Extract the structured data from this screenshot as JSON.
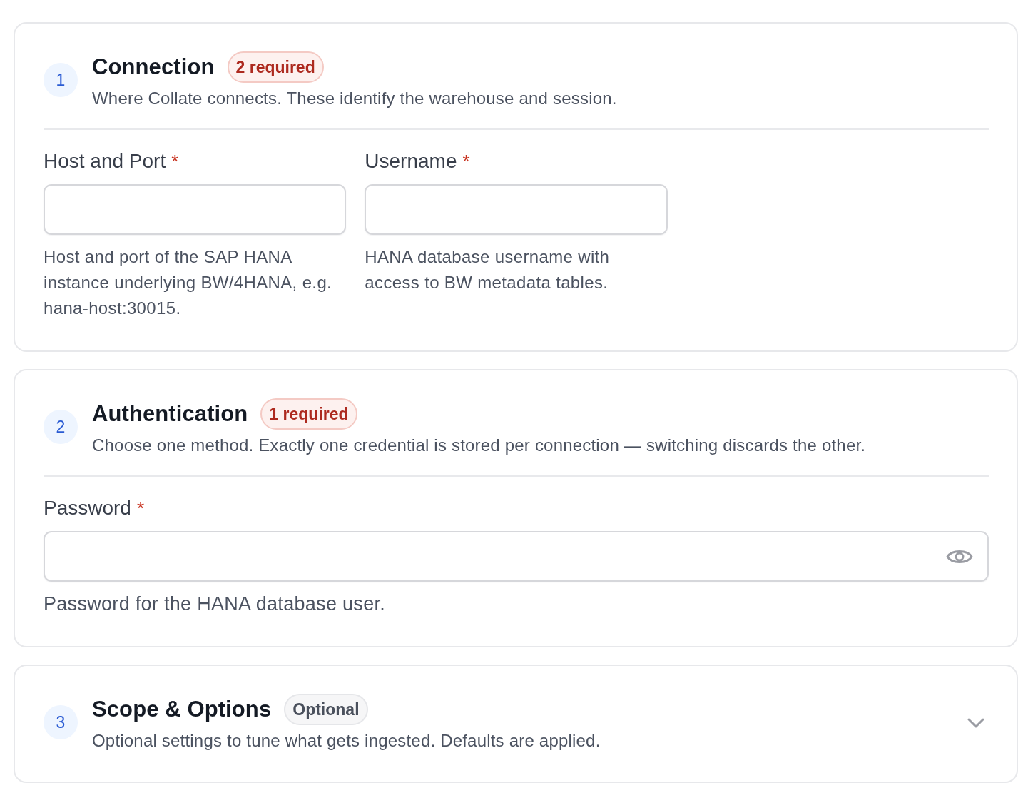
{
  "sections": [
    {
      "number": "1",
      "title": "Connection",
      "badge": {
        "kind": "required",
        "text": "2 required"
      },
      "description": "Where Collate connects. These identify the warehouse and session.",
      "expanded": true,
      "fields": [
        {
          "kind": "text",
          "label": "Host and Port",
          "required_mark": "*",
          "help": "Host and port of the SAP HANA instance underlying BW/4HANA, e.g. hana-host:30015."
        },
        {
          "kind": "text",
          "label": "Username",
          "required_mark": "*",
          "help": "HANA database username with access to BW metadata tables."
        }
      ]
    },
    {
      "number": "2",
      "title": "Authentication",
      "badge": {
        "kind": "required",
        "text": "1 required"
      },
      "description": "Choose one method. Exactly one credential is stored per connection — switching discards the other.",
      "expanded": true,
      "fields": [
        {
          "kind": "password",
          "label": "Password",
          "required_mark": "*",
          "help": "Password for the HANA database user."
        }
      ]
    },
    {
      "number": "3",
      "title": "Scope & Options",
      "badge": {
        "kind": "optional",
        "text": "Optional"
      },
      "description": "Optional settings to tune what gets ingested. Defaults are applied.",
      "expanded": false
    }
  ]
}
